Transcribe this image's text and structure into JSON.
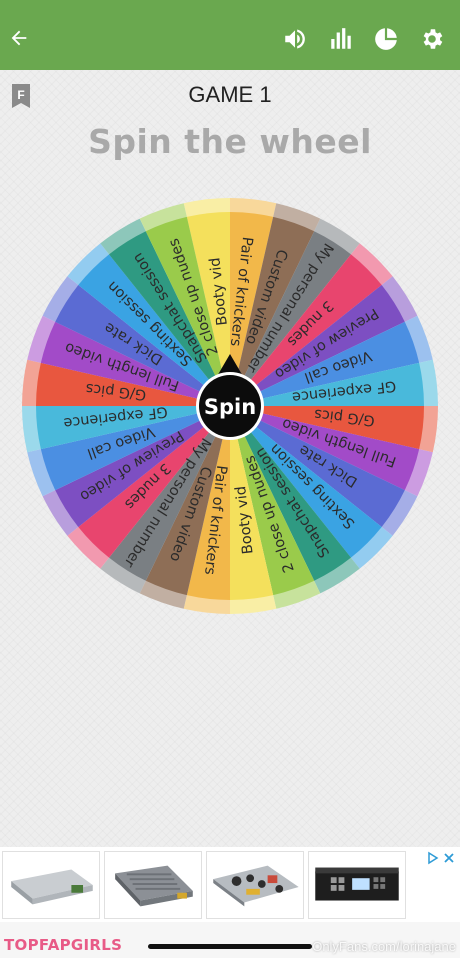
{
  "header": {
    "icons": [
      "back-arrow-icon",
      "volume-icon",
      "bar-chart-icon",
      "pie-chart-icon",
      "gear-icon"
    ],
    "bar_color": "#6aa84f"
  },
  "bookmark_letter": "F",
  "game_title": "GAME 1",
  "headline": "Spin the wheel",
  "wheel": {
    "center_label": "Spin",
    "segments": [
      {
        "label": "Booty vid",
        "color": "#f4e05c"
      },
      {
        "label": "Pair of knickers",
        "color": "#f2b84a"
      },
      {
        "label": "Custom video",
        "color": "#8e6e56"
      },
      {
        "label": "My personal number",
        "color": "#7a7f83"
      },
      {
        "label": "3 nudes",
        "color": "#e8456e"
      },
      {
        "label": "Preview of video",
        "color": "#7d4fc2"
      },
      {
        "label": "Video call",
        "color": "#4b8fe2"
      },
      {
        "label": "GF experience",
        "color": "#49b9db"
      },
      {
        "label": "G/G pics",
        "color": "#e8573f"
      },
      {
        "label": "Full length video",
        "color": "#a24bc8"
      },
      {
        "label": "Dick rate",
        "color": "#5b6bd3"
      },
      {
        "label": "Sexting session",
        "color": "#3aa3e3"
      },
      {
        "label": "Snapchat session",
        "color": "#2f9a82"
      },
      {
        "label": "2 close up nudes",
        "color": "#9acb4b"
      },
      {
        "label": "Booty vid",
        "color": "#f4e05c"
      },
      {
        "label": "Pair of knickers",
        "color": "#f2b84a"
      },
      {
        "label": "Custom video",
        "color": "#8e6e56"
      },
      {
        "label": "My personal number",
        "color": "#7a7f83"
      },
      {
        "label": "3 nudes",
        "color": "#e8456e"
      },
      {
        "label": "Preview of video",
        "color": "#7d4fc2"
      },
      {
        "label": "Video call",
        "color": "#4b8fe2"
      },
      {
        "label": "GF experience",
        "color": "#49b9db"
      },
      {
        "label": "G/G pics",
        "color": "#e8573f"
      },
      {
        "label": "Full length video",
        "color": "#a24bc8"
      },
      {
        "label": "Dick rate",
        "color": "#5b6bd3"
      },
      {
        "label": "Sexting session",
        "color": "#3aa3e3"
      },
      {
        "label": "Snapchat session",
        "color": "#2f9a82"
      },
      {
        "label": "2 close up nudes",
        "color": "#9acb4b"
      }
    ]
  },
  "ads": {
    "items": [
      "power-supply-product",
      "led-driver-product",
      "open-frame-psu-product",
      "video-switcher-product"
    ],
    "choices_label": "▷✕"
  },
  "watermarks": {
    "left": "TOPFAPGIRLS",
    "right": "OnlyFans.com/lorinajane"
  }
}
